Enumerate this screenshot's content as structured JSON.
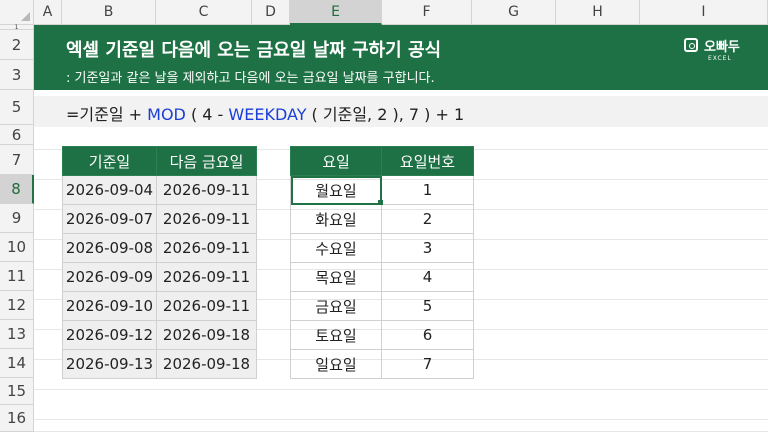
{
  "columns": [
    "A",
    "B",
    "C",
    "D",
    "E",
    "F",
    "G",
    "H",
    "I"
  ],
  "rows": [
    "1",
    "2",
    "3",
    "5",
    "6",
    "7",
    "8",
    "9",
    "10",
    "11",
    "12",
    "13",
    "14",
    "15",
    "16"
  ],
  "active_column": "E",
  "active_row": "8",
  "banner": {
    "title": "엑셀 기준일 다음에 오는 금요일 날짜 구하기 공식",
    "subtitle": ": 기준일과 같은 날을 제외하고 다음에 오는 금요일 날짜를 구합니다.",
    "logo_text": "오빠두",
    "logo_sub": "EXCEL",
    "color": "#1e7145"
  },
  "formula": {
    "p1": "=기준일 + ",
    "fn1": "MOD",
    "p2": " ( 4 - ",
    "fn2": "WEEKDAY",
    "p3": " ( 기준일, 2 ), 7 ) + 1"
  },
  "table1": {
    "headers": [
      "기준일",
      "다음 금요일"
    ],
    "rows": [
      [
        "2026-09-04",
        "2026-09-11"
      ],
      [
        "2026-09-07",
        "2026-09-11"
      ],
      [
        "2026-09-08",
        "2026-09-11"
      ],
      [
        "2026-09-09",
        "2026-09-11"
      ],
      [
        "2026-09-10",
        "2026-09-11"
      ],
      [
        "2026-09-12",
        "2026-09-18"
      ],
      [
        "2026-09-13",
        "2026-09-18"
      ]
    ]
  },
  "table2": {
    "headers": [
      "요일",
      "요일번호"
    ],
    "rows": [
      [
        "월요일",
        "1"
      ],
      [
        "화요일",
        "2"
      ],
      [
        "수요일",
        "3"
      ],
      [
        "목요일",
        "4"
      ],
      [
        "금요일",
        "5"
      ],
      [
        "토요일",
        "6"
      ],
      [
        "일요일",
        "7"
      ]
    ]
  }
}
